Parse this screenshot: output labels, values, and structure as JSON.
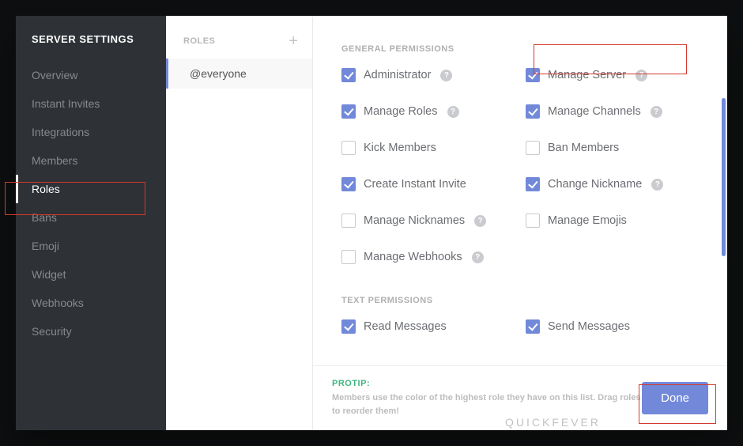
{
  "sidebar": {
    "title": "SERVER SETTINGS",
    "items": [
      {
        "label": "Overview",
        "active": false
      },
      {
        "label": "Instant Invites",
        "active": false
      },
      {
        "label": "Integrations",
        "active": false
      },
      {
        "label": "Members",
        "active": false
      },
      {
        "label": "Roles",
        "active": true
      },
      {
        "label": "Bans",
        "active": false
      },
      {
        "label": "Emoji",
        "active": false
      },
      {
        "label": "Widget",
        "active": false
      },
      {
        "label": "Webhooks",
        "active": false
      },
      {
        "label": "Security",
        "active": false
      }
    ]
  },
  "roles": {
    "header": "ROLES",
    "add_icon": "+",
    "items": [
      {
        "label": "@everyone",
        "active": true
      }
    ]
  },
  "permissions": {
    "sections": [
      {
        "title": "GENERAL PERMISSIONS",
        "items": [
          {
            "label": "Administrator",
            "checked": true,
            "help": true
          },
          {
            "label": "Manage Server",
            "checked": true,
            "help": true,
            "highlighted": true
          },
          {
            "label": "Manage Roles",
            "checked": true,
            "help": true
          },
          {
            "label": "Manage Channels",
            "checked": true,
            "help": true
          },
          {
            "label": "Kick Members",
            "checked": false,
            "help": false
          },
          {
            "label": "Ban Members",
            "checked": false,
            "help": false
          },
          {
            "label": "Create Instant Invite",
            "checked": true,
            "help": false
          },
          {
            "label": "Change Nickname",
            "checked": true,
            "help": true
          },
          {
            "label": "Manage Nicknames",
            "checked": false,
            "help": true
          },
          {
            "label": "Manage Emojis",
            "checked": false,
            "help": false
          },
          {
            "label": "Manage Webhooks",
            "checked": false,
            "help": true
          }
        ]
      },
      {
        "title": "TEXT PERMISSIONS",
        "items": [
          {
            "label": "Read Messages",
            "checked": true,
            "help": false
          },
          {
            "label": "Send Messages",
            "checked": true,
            "help": false
          }
        ]
      }
    ]
  },
  "footer": {
    "protip_title": "PROTIP:",
    "protip_text": "Members use the color of the highest role they have on this list. Drag roles to reorder them!",
    "done_label": "Done"
  },
  "watermark": "QUICKFEVER"
}
